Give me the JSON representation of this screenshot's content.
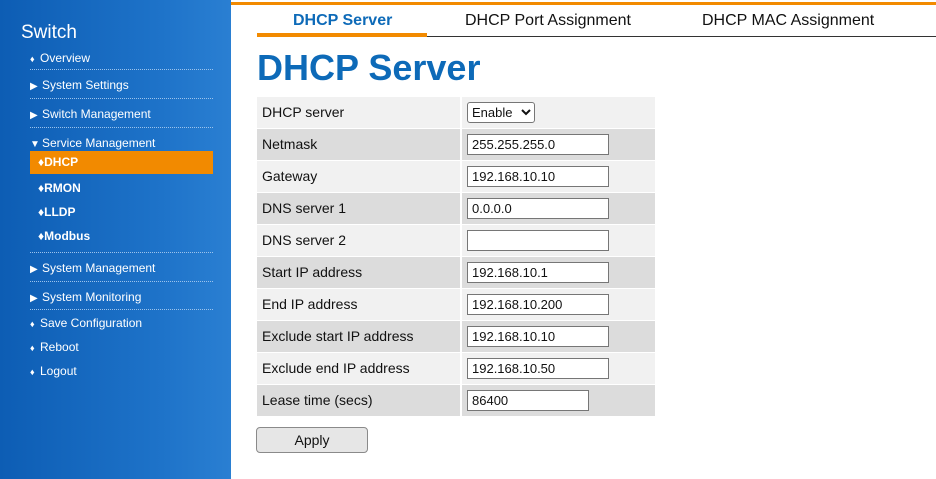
{
  "sidebar": {
    "brand": "Switch",
    "items": [
      {
        "label": "Overview",
        "marker": "♦"
      },
      {
        "label": "System Settings",
        "marker": "▶"
      },
      {
        "label": "Switch Management",
        "marker": "▶"
      },
      {
        "label": "Service Management",
        "marker": "▼"
      },
      {
        "label": "System Management",
        "marker": "▶"
      },
      {
        "label": "System Monitoring",
        "marker": "▶"
      },
      {
        "label": "Save Configuration",
        "marker": "♦"
      },
      {
        "label": "Reboot",
        "marker": "♦"
      },
      {
        "label": "Logout",
        "marker": "♦"
      }
    ],
    "service_sub": [
      {
        "label": "DHCP",
        "marker": "♦",
        "active": true
      },
      {
        "label": "RMON",
        "marker": "♦"
      },
      {
        "label": "LLDP",
        "marker": "♦"
      },
      {
        "label": "Modbus",
        "marker": "♦"
      }
    ]
  },
  "tabs": [
    {
      "label": "DHCP Server",
      "active": true
    },
    {
      "label": "DHCP Port Assignment"
    },
    {
      "label": "DHCP MAC Assignment"
    }
  ],
  "page_title": "DHCP Server",
  "form": {
    "dhcp_server": {
      "label": "DHCP server",
      "value": "Enable",
      "options": [
        "Enable"
      ]
    },
    "netmask": {
      "label": "Netmask",
      "value": "255.255.255.0"
    },
    "gateway": {
      "label": "Gateway",
      "value": "192.168.10.10"
    },
    "dns1": {
      "label": "DNS server 1",
      "value": "0.0.0.0"
    },
    "dns2": {
      "label": "DNS server 2",
      "value": ""
    },
    "start_ip": {
      "label": "Start IP address",
      "value": "192.168.10.1"
    },
    "end_ip": {
      "label": "End IP address",
      "value": "192.168.10.200"
    },
    "excl_start": {
      "label": "Exclude start IP address",
      "value": "192.168.10.10"
    },
    "excl_end": {
      "label": "Exclude end IP address",
      "value": "192.168.10.50"
    },
    "lease": {
      "label": "Lease time (secs)",
      "value": "86400"
    }
  },
  "apply_label": "Apply",
  "colors": {
    "accent": "#f28a00",
    "sidebar": "#1565c0",
    "title": "#0d6ab8"
  }
}
